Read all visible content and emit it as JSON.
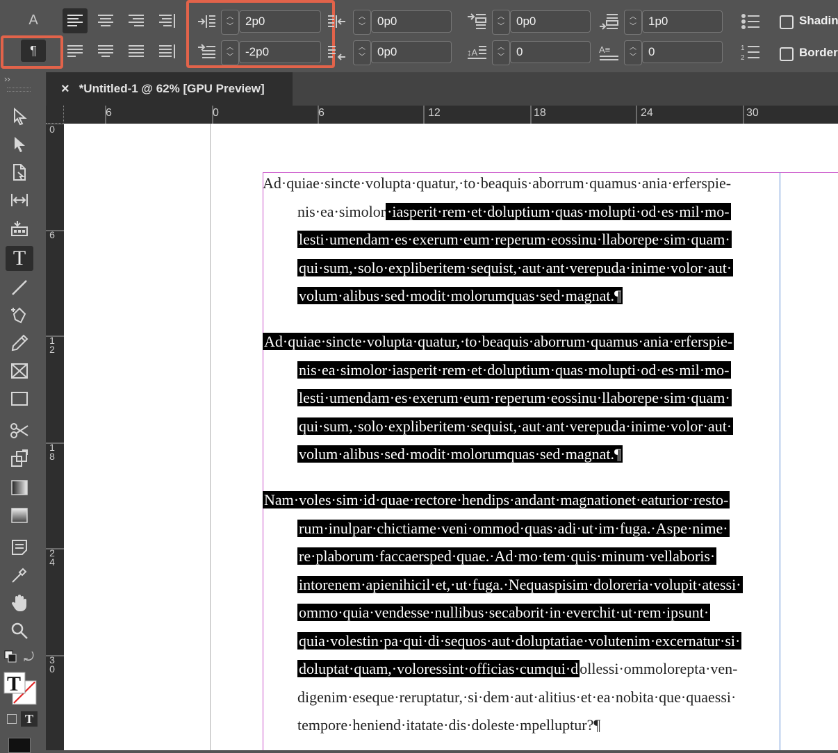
{
  "control_panel": {
    "char_mode_label": "A",
    "para_mode_label": "¶",
    "left_indent": "2p0",
    "first_line_indent": "-2p0",
    "right_indent": "0p0",
    "last_line_right_indent": "0p0",
    "space_before": "0p0",
    "space_after": "1p0",
    "drop_cap_lines": "0",
    "drop_cap_chars": "0",
    "shading_label": "Shadin",
    "border_label": "Border"
  },
  "document_tab": {
    "title": "*Untitled-1 @ 62% [GPU Preview]",
    "close_glyph": "×"
  },
  "rulers": {
    "horizontal_ticks": [
      "6",
      "0",
      "6",
      "12",
      "18",
      "24",
      "30"
    ],
    "vertical_ticks": [
      "0",
      "6",
      "1\n2",
      "1\n8",
      "2\n4",
      "3\n0"
    ]
  },
  "text_frame": {
    "paragraphs": [
      {
        "lines": [
          {
            "plain": "Ad·quiae·sincte·volupta·quatur,·to·beaquis·aborrum·quamus·ania·erferspie-",
            "selected": ""
          },
          {
            "plain": "nis·ea·simolor",
            "selected": "·iasperit·rem·et·doluptium·quas·molupti·od·es·mil·mo-"
          },
          {
            "plain": "",
            "selected": "lesti·umendam·es·exerum·eum·reperum·eossinu·llaborepe·sim·quam·"
          },
          {
            "plain": "",
            "selected": "qui·sum,·solo·expliberitem·sequist,·aut·ant·verepuda·inime·volor·aut·"
          },
          {
            "plain": "",
            "selected": "volum·alibus·sed·modit·molorumquas·sed·magnat.¶"
          }
        ]
      },
      {
        "lines": [
          {
            "plain": "",
            "selected": "Ad·quiae·sincte·volupta·quatur,·to·beaquis·aborrum·quamus·ania·erferspie-"
          },
          {
            "plain": "",
            "selected": "nis·ea·simolor·iasperit·rem·et·doluptium·quas·molupti·od·es·mil·mo-"
          },
          {
            "plain": "",
            "selected": "lesti·umendam·es·exerum·eum·reperum·eossinu·llaborepe·sim·quam·"
          },
          {
            "plain": "",
            "selected": "qui·sum,·solo·expliberitem·sequist,·aut·ant·verepuda·inime·volor·aut·"
          },
          {
            "plain": "",
            "selected": "volum·alibus·sed·modit·molorumquas·sed·magnat.¶"
          }
        ]
      },
      {
        "lines": [
          {
            "plain": "",
            "selected": "Nam·voles·sim·id·quae·rectore·hendips·andant·magnationet·eaturior·resto-"
          },
          {
            "plain": "",
            "selected": "rum·inulpar·chictiame·veni·ommod·quas·adi·ut·im·fuga.·Aspe·nime·"
          },
          {
            "plain": "",
            "selected": "re·plaborum·faccaersped·quae.·Ad·mo·tem·quis·minum·vellaboris·"
          },
          {
            "plain": "",
            "selected": "intorenem·apienihicil·et,·ut·fuga.·Nequaspisim·doloreria·volupit·atessi·"
          },
          {
            "plain": "",
            "selected": "ommo·quia·vendesse·nullibus·secaborit·in·everchit·ut·rem·ipsunt·"
          },
          {
            "plain": "",
            "selected": "quia·volestin·pa·qui·di·sequos·aut·doluptatiae·volutenim·excernatur·si·"
          },
          {
            "plain": "",
            "selected": "doluptat·quam,·voloressint·officias·cumqui·d",
            "after": "ollessi·ommolorepta·ven-"
          },
          {
            "plain": "digenim·eseque·reruptatur,·si·dem·aut·alitius·et·ea·nobita·que·quaessi·",
            "selected": ""
          },
          {
            "plain": "tempore·heniend·itatate·dis·doleste·mpelluptur?¶",
            "selected": ""
          }
        ]
      }
    ]
  },
  "colors": {
    "highlight": "#e2634a",
    "frame_edge": "#c94fc9",
    "margin_guide": "#5a8ad4"
  }
}
